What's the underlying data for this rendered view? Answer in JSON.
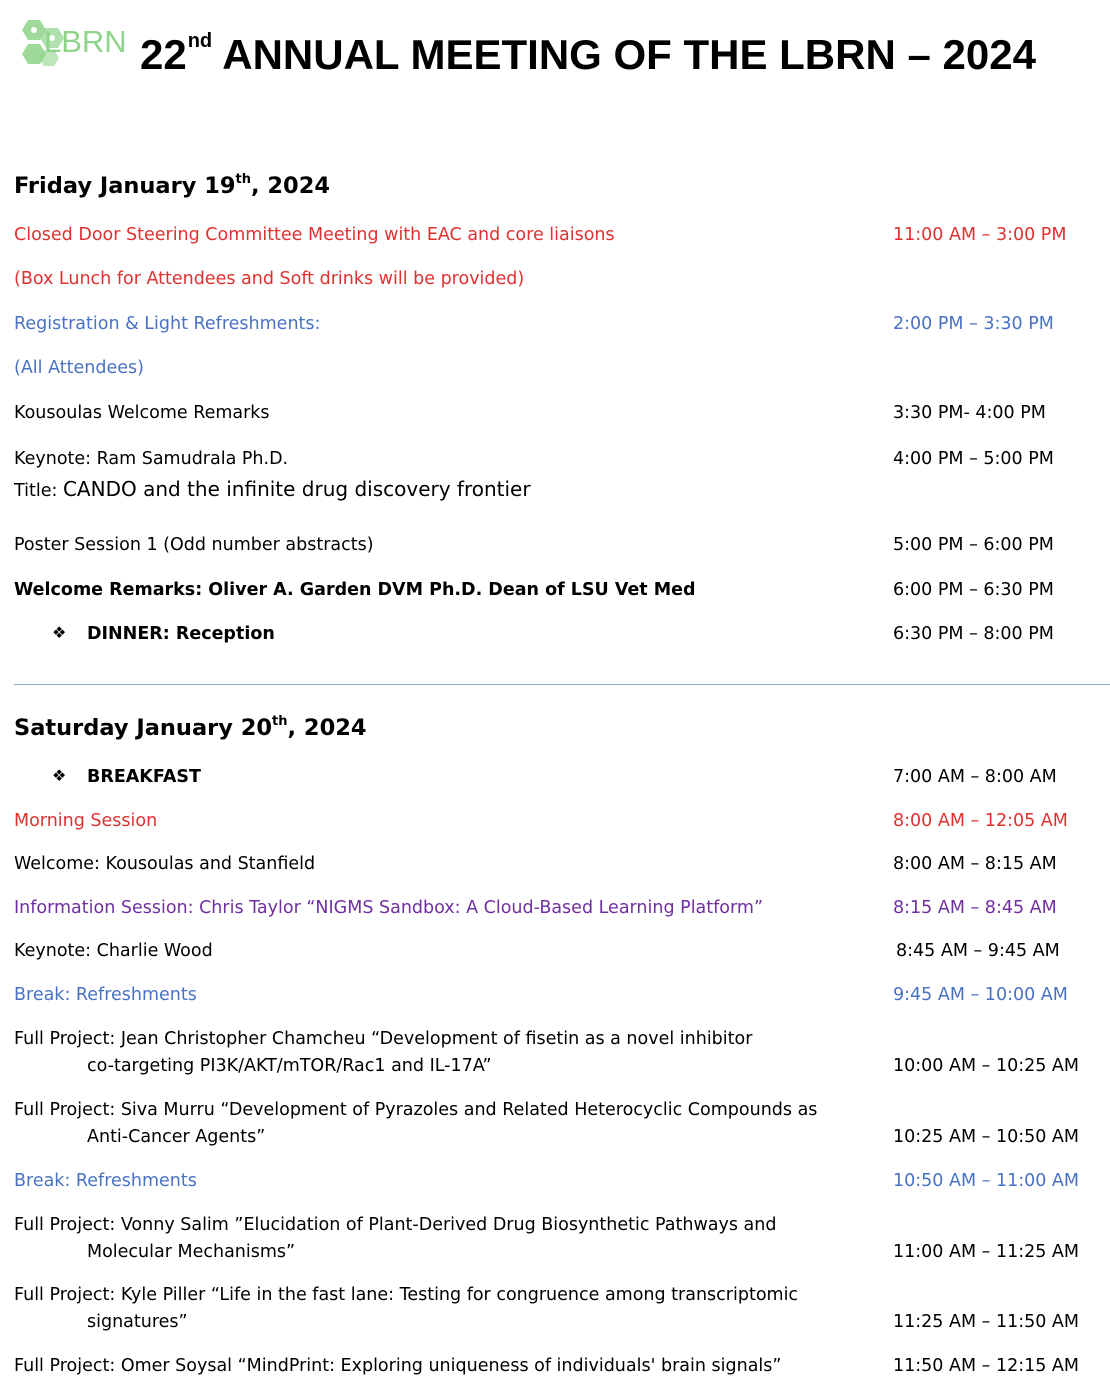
{
  "header": {
    "logo_text": "LBRN",
    "title_pre": "22",
    "title_sup": "nd",
    "title_post": " ANNUAL MEETING OF THE LBRN – 2024"
  },
  "day1": {
    "heading_pre": "Friday January 19",
    "heading_sup": "th",
    "heading_post": ", 2024",
    "items": [
      {
        "label": "Closed Door Steering Committee Meeting with EAC and core liaisons",
        "time": "11:00 AM – 3:00 PM"
      },
      {
        "label": "(Box Lunch for Attendees and Soft drinks will be provided)",
        "time": ""
      },
      {
        "label": "Registration & Light Refreshments:",
        "time": "2:00 PM – 3:30 PM"
      },
      {
        "label": "(All Attendees)",
        "time": ""
      },
      {
        "label": "Kousoulas Welcome Remarks",
        "time": "3:30 PM- 4:00 PM"
      },
      {
        "label": "Keynote: Ram Samudrala Ph.D.",
        "time": "4:00 PM – 5:00 PM"
      },
      {
        "label_prefix": "Title: ",
        "label": "CANDO and the infinite drug discovery frontier",
        "time": ""
      },
      {
        "label": "Poster Session 1 (Odd number abstracts)",
        "time": "5:00 PM – 6:00 PM"
      },
      {
        "label": "Welcome Remarks: Oliver A. Garden DVM Ph.D. Dean of LSU Vet Med",
        "time": "6:00 PM – 6:30 PM"
      },
      {
        "bullet": "❖",
        "label": "DINNER: Reception",
        "time": "6:30 PM – 8:00 PM"
      }
    ]
  },
  "day2": {
    "heading_pre": "Saturday January 20",
    "heading_sup": "th",
    "heading_post": ", 2024",
    "items": [
      {
        "bullet": "❖",
        "label": "BREAKFAST",
        "time": "7:00 AM – 8:00 AM"
      },
      {
        "label": "Morning Session",
        "time": "8:00 AM – 12:05 AM"
      },
      {
        "label": "Welcome: Kousoulas and Stanfield",
        "time": "8:00 AM – 8:15 AM"
      },
      {
        "label": "Information Session: Chris Taylor “NIGMS Sandbox: A Cloud-Based Learning Platform”",
        "time": "8:15 AM – 8:45 AM"
      },
      {
        "label": "Keynote: Charlie Wood",
        "time": "8:45 AM – 9:45 AM"
      },
      {
        "label": "Break: Refreshments",
        "time": "9:45 AM – 10:00 AM"
      },
      {
        "line1": "Full Project: Jean Christopher Chamcheu “Development of fisetin as a novel inhibitor",
        "line2": "co-targeting PI3K/AKT/mTOR/Rac1 and IL-17A”",
        "time": "10:00 AM – 10:25 AM"
      },
      {
        "line1": "Full Project: Siva Murru “Development of Pyrazoles and Related Heterocyclic Compounds as",
        "line2": "Anti-Cancer Agents”",
        "time": "10:25 AM – 10:50 AM"
      },
      {
        "label": "Break: Refreshments",
        "time": "10:50 AM – 11:00 AM"
      },
      {
        "line1": "Full Project: Vonny Salim ”Elucidation of Plant-Derived Drug Biosynthetic Pathways and",
        "line2": "Molecular Mechanisms”",
        "time": "11:00 AM – 11:25 AM"
      },
      {
        "line1": "Full Project: Kyle Piller “Life in the fast lane: Testing for congruence among transcriptomic",
        "line2": "signatures”",
        "time": "11:25 AM – 11:50 AM"
      },
      {
        "label": "Full Project: Omer Soysal “MindPrint: Exploring uniqueness of individuals' brain signals”",
        "time": "11:50 AM – 12:15 AM"
      }
    ]
  },
  "colors": {
    "red": "#e03131",
    "blue": "#4a72c4",
    "purple": "#7030a0",
    "logo_green": "#8fd48a"
  }
}
